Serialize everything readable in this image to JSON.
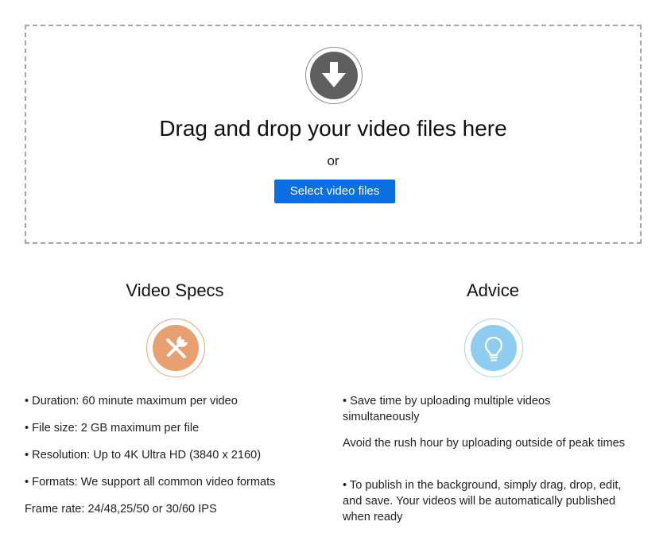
{
  "upload": {
    "icon": "download-arrow-icon",
    "title": "Drag and drop your video files here",
    "or_text": "or",
    "button_label": "Select video files",
    "button_color": "#0b6fe4"
  },
  "specs": {
    "title": "Video Specs",
    "icon": "tools-icon",
    "icon_color": "#e8a070",
    "items": [
      "• Duration: 60 minute maximum per video",
      "• File size: 2 GB maximum per file",
      "• Resolution: Up to 4K Ultra HD (3840 x 2160)",
      "• Formats: We support all common video formats",
      "Frame rate: 24/48,25/50 or 30/60 IPS"
    ]
  },
  "advice": {
    "title": "Advice",
    "icon": "lightbulb-icon",
    "icon_color": "#8ecdf0",
    "items": [
      "• Save time by uploading multiple videos simultaneously",
      "Avoid the rush hour by uploading outside of peak times",
      "• To publish in the background, simply drag, drop, edit, and save. Your videos will be automatically published when ready"
    ]
  }
}
